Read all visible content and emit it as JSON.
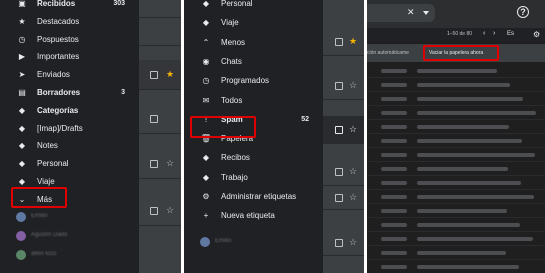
{
  "panel1": {
    "nav": [
      {
        "icon": "inbox-icon",
        "glyph": "▣",
        "label": "Recibidos",
        "count": "303",
        "bold": true
      },
      {
        "icon": "star-icon",
        "glyph": "★",
        "label": "Destacados",
        "count": "",
        "bold": false
      },
      {
        "icon": "clock-icon",
        "glyph": "◷",
        "label": "Pospuestos",
        "count": "",
        "bold": false
      },
      {
        "icon": "important-icon",
        "glyph": "▶",
        "label": "Importantes",
        "count": "",
        "bold": false
      },
      {
        "icon": "send-icon",
        "glyph": "➤",
        "label": "Enviados",
        "count": "",
        "bold": false
      },
      {
        "icon": "draft-icon",
        "glyph": "▤",
        "label": "Borradores",
        "count": "3",
        "bold": true
      },
      {
        "icon": "label-icon",
        "glyph": "◆",
        "label": "Categorías",
        "count": "",
        "bold": true
      },
      {
        "icon": "label-icon",
        "glyph": "◆",
        "label": "[Imap]/Drafts",
        "count": "",
        "bold": false
      },
      {
        "icon": "label-icon",
        "glyph": "◆",
        "label": "Notes",
        "count": "",
        "bold": false
      },
      {
        "icon": "label-icon",
        "glyph": "◆",
        "label": "Personal",
        "count": "",
        "bold": false
      },
      {
        "icon": "label-icon",
        "glyph": "◆",
        "label": "Viaje",
        "count": "",
        "bold": false
      },
      {
        "icon": "chevron-down-icon",
        "glyph": "⌄",
        "label": "Más",
        "count": "",
        "bold": false
      }
    ],
    "contacts": [
      "Emilio",
      "Agustín Dado",
      "allen lozo"
    ]
  },
  "panel2": {
    "nav": [
      {
        "icon": "label-icon",
        "glyph": "◆",
        "label": "Personal",
        "count": "",
        "bold": false
      },
      {
        "icon": "label-icon",
        "glyph": "◆",
        "label": "Viaje",
        "count": "",
        "bold": false
      },
      {
        "icon": "chevron-up-icon",
        "glyph": "⌃",
        "label": "Menos",
        "count": "",
        "bold": false
      },
      {
        "icon": "chat-icon",
        "glyph": "◉",
        "label": "Chats",
        "count": "",
        "bold": false
      },
      {
        "icon": "scheduled-icon",
        "glyph": "◷",
        "label": "Programados",
        "count": "",
        "bold": false
      },
      {
        "icon": "all-mail-icon",
        "glyph": "✉",
        "label": "Todos",
        "count": "",
        "bold": false
      },
      {
        "icon": "spam-icon",
        "glyph": "!",
        "label": "Spam",
        "count": "52",
        "bold": true
      },
      {
        "icon": "trash-icon",
        "glyph": "🗑",
        "label": "Papelera",
        "count": "",
        "bold": false
      },
      {
        "icon": "label-icon",
        "glyph": "◆",
        "label": "Recibos",
        "count": "",
        "bold": false
      },
      {
        "icon": "label-icon",
        "glyph": "◆",
        "label": "Trabajo",
        "count": "",
        "bold": false
      },
      {
        "icon": "gear-icon",
        "glyph": "⚙",
        "label": "Administrar etiquetas",
        "count": "",
        "bold": false
      },
      {
        "icon": "plus-icon",
        "glyph": "+",
        "label": "Nueva etiqueta",
        "count": "",
        "bold": false
      }
    ],
    "contacts": [
      "Emilio"
    ]
  },
  "panel3": {
    "close_glyph": "✕",
    "pagination": "1–50 de 80",
    "lang": "Es",
    "help_glyph": "?",
    "settings_glyph": "⚙",
    "banner_left": "ción automáticame",
    "banner_button": "Vaciar la papelera ahora"
  },
  "colors": {
    "highlight": "#e00000",
    "star_gold": "#f4b400"
  }
}
